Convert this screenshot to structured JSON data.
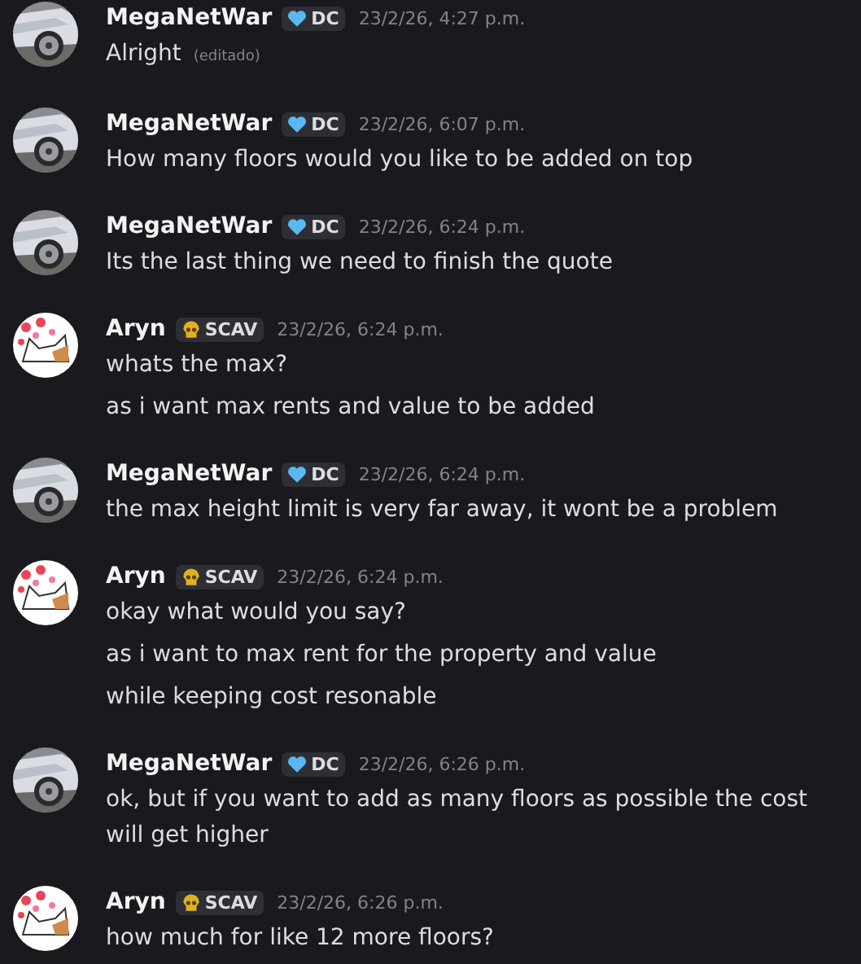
{
  "groups": [
    {
      "author": "MegaNetWar",
      "badge": {
        "kind": "heart",
        "tag": "DC"
      },
      "timestamp": "23/2/26, 4:27 p.m.",
      "messages": [
        {
          "text": "Alright",
          "edited": "(editado)"
        }
      ]
    },
    {
      "author": "MegaNetWar",
      "badge": {
        "kind": "heart",
        "tag": "DC"
      },
      "timestamp": "23/2/26, 6:07 p.m.",
      "messages": [
        {
          "text": "How many floors would you like to be added on top"
        }
      ]
    },
    {
      "author": "MegaNetWar",
      "badge": {
        "kind": "heart",
        "tag": "DC"
      },
      "timestamp": "23/2/26, 6:24 p.m.",
      "messages": [
        {
          "text": "Its the last thing we need to finish the quote"
        }
      ]
    },
    {
      "author": "Aryn",
      "badge": {
        "kind": "skull",
        "tag": "SCAV"
      },
      "timestamp": "23/2/26, 6:24 p.m.",
      "messages": [
        {
          "text": "whats the max?"
        },
        {
          "text": "as i want max rents and value to be added"
        }
      ]
    },
    {
      "author": "MegaNetWar",
      "badge": {
        "kind": "heart",
        "tag": "DC"
      },
      "timestamp": "23/2/26, 6:24 p.m.",
      "messages": [
        {
          "text": "the max height limit is very far away, it wont be a problem"
        }
      ]
    },
    {
      "author": "Aryn",
      "badge": {
        "kind": "skull",
        "tag": "SCAV"
      },
      "timestamp": "23/2/26, 6:24 p.m.",
      "messages": [
        {
          "text": "okay what would you say?"
        },
        {
          "text": "as i want to max rent for the property and value"
        },
        {
          "text": "while keeping cost resonable"
        }
      ]
    },
    {
      "author": "MegaNetWar",
      "badge": {
        "kind": "heart",
        "tag": "DC"
      },
      "timestamp": "23/2/26, 6:26 p.m.",
      "messages": [
        {
          "text": "ok, but if you want to add as many floors as possible the cost will get higher"
        }
      ]
    },
    {
      "author": "Aryn",
      "badge": {
        "kind": "skull",
        "tag": "SCAV"
      },
      "timestamp": "23/2/26, 6:26 p.m.",
      "messages": [
        {
          "text": "how much for like 12 more floors?"
        }
      ]
    }
  ]
}
